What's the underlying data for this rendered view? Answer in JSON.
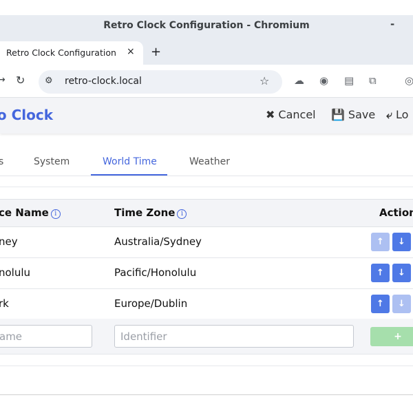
{
  "window": {
    "title": "Retro Clock Configuration - Chromium",
    "minimize": "-"
  },
  "browser": {
    "tab_title": "Retro Clock Configuration",
    "tab_close": "×",
    "new_tab": "+",
    "url": "retro-clock.local",
    "icons": [
      "tune-icon",
      "star-icon",
      "cloud-icon",
      "camera-icon",
      "easel-icon",
      "puzzle-icon",
      "profile-icon"
    ]
  },
  "app": {
    "brand": "ro Clock",
    "actions": {
      "cancel": {
        "label": "Cancel",
        "icon": "✖"
      },
      "save": {
        "label": "Save",
        "icon": "💾"
      },
      "logout": {
        "label": "Lo",
        "icon": "⤶"
      }
    },
    "accent": "#4466dd"
  },
  "tabs": [
    {
      "label": "s",
      "active": false
    },
    {
      "label": "System",
      "active": false
    },
    {
      "label": "World Time",
      "active": true
    },
    {
      "label": "Weather",
      "active": false
    }
  ],
  "table": {
    "headers": {
      "place": "ce Name",
      "timezone": "Time Zone",
      "actions": "Action"
    },
    "info_glyph": "i",
    "rows": [
      {
        "place": "ney",
        "timezone": "Australia/Sydney",
        "up": "↑",
        "down": "↓",
        "up_disabled": true,
        "down_disabled": false
      },
      {
        "place": "nolulu",
        "timezone": "Pacific/Honolulu",
        "up": "↑",
        "down": "↓",
        "up_disabled": false,
        "down_disabled": false
      },
      {
        "place": "rk",
        "timezone": "Europe/Dublin",
        "up": "↑",
        "down": "↓",
        "up_disabled": false,
        "down_disabled": true
      }
    ],
    "add_row": {
      "name_placeholder": "ame",
      "tz_placeholder": "Identifier",
      "add_label": "+"
    }
  }
}
